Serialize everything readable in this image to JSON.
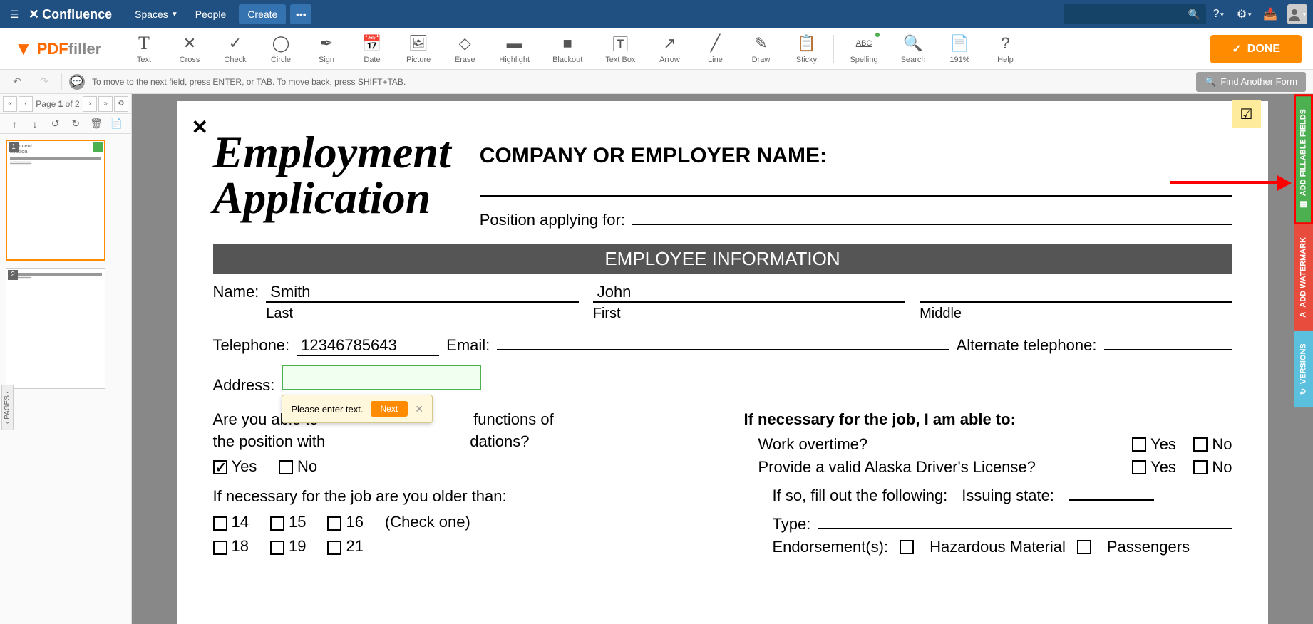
{
  "confluence": {
    "logo": "Confluence",
    "spaces": "Spaces",
    "people": "People",
    "create": "Create"
  },
  "pdffiller": {
    "logo_pdf": "PDF",
    "logo_filler": "filler",
    "tools": {
      "text": "Text",
      "cross": "Cross",
      "check": "Check",
      "circle": "Circle",
      "sign": "Sign",
      "date": "Date",
      "picture": "Picture",
      "erase": "Erase",
      "highlight": "Highlight",
      "blackout": "Blackout",
      "textbox": "Text Box",
      "arrow": "Arrow",
      "line": "Line",
      "draw": "Draw",
      "sticky": "Sticky",
      "spelling": "Spelling",
      "spelling_abc": "ABC",
      "search": "Search",
      "zoom": "191%",
      "help": "Help"
    },
    "done": "DONE"
  },
  "subbar": {
    "hint": "To move to the next field, press ENTER, or TAB. To move back, press SHIFT+TAB.",
    "find_form": "Find Another Form"
  },
  "page_nav": {
    "label_prefix": "Page ",
    "current": "1",
    "label_suffix": " of 2"
  },
  "document": {
    "title_line1": "Employment",
    "title_line2": "Application",
    "company_label": "COMPANY OR EMPLOYER NAME:",
    "position_label": "Position applying for:",
    "section_employee": "EMPLOYEE INFORMATION",
    "name_label": "Name:",
    "name_last": "Smith",
    "name_first": "John",
    "sub_last": "Last",
    "sub_first": "First",
    "sub_middle": "Middle",
    "tel_label": "Telephone:",
    "tel_value": "12346785643",
    "email_label": "Email:",
    "alt_tel_label": "Alternate telephone:",
    "address_label": "Address:",
    "q1_line1": "Are you able to",
    "q1_line1b": "functions of",
    "q1_line2": "the position with",
    "q1_line2b": "dations?",
    "yes": "Yes",
    "no": "No",
    "q2": "If necessary for the job are you older than:",
    "age_14": "14",
    "age_15": "15",
    "age_16": "16",
    "age_18": "18",
    "age_19": "19",
    "age_21": "21",
    "check_one": "(Check one)",
    "q3_header": "If necessary for the job, I am able to:",
    "q3_overtime": "Work overtime?",
    "q3_license": "Provide a valid Alaska Driver's License?",
    "q3_ifso": "If so, fill out the following:",
    "q3_state": "Issuing state:",
    "q3_type": "Type:",
    "q3_endorse": "Endorsement(s):",
    "q3_hazmat": "Hazardous Material",
    "q3_passengers": "Passengers"
  },
  "tooltip": {
    "text": "Please enter text.",
    "next": "Next"
  },
  "right_tabs": {
    "fillable": "ADD FILLABLE FIELDS",
    "watermark": "ADD WATERMARK",
    "versions": "VERSIONS"
  }
}
